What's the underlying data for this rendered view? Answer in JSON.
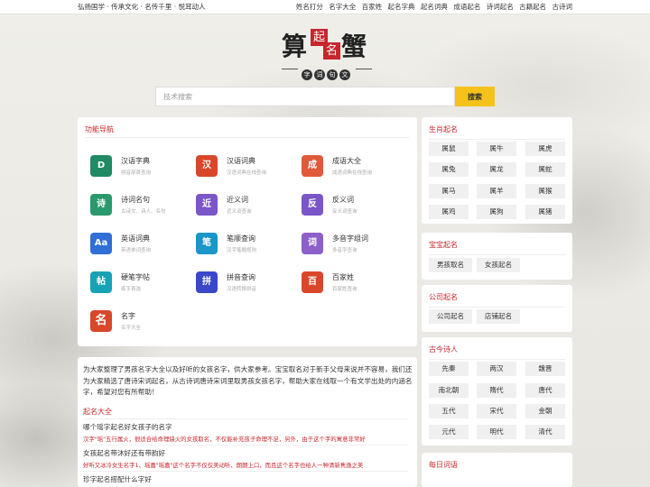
{
  "topbar": {
    "slogan": "弘扬国学 · 传承文化 · 名传千里 · 悦耳动人",
    "links": [
      "姓名打分",
      "名字大全",
      "百家姓",
      "起名字典",
      "起名词典",
      "成语起名",
      "诗词起名",
      "古籍起名",
      "古诗词"
    ]
  },
  "logo": {
    "char1": "算",
    "seal1": "起",
    "seal2": "名",
    "char2": "蟹",
    "sub": [
      "字",
      "词",
      "句",
      "文"
    ]
  },
  "search": {
    "placeholder": "技术搜索",
    "button": "搜索"
  },
  "funcnav": {
    "title": "功能导航",
    "tools": [
      {
        "name": "汉语字典",
        "desc": "拼音部首查询",
        "glyph": "D",
        "color": "#1f8a63"
      },
      {
        "name": "汉语词典",
        "desc": "汉语词典在线查询",
        "glyph": "汉",
        "color": "#d9472b"
      },
      {
        "name": "成语大全",
        "desc": "成语词典在线查询",
        "glyph": "成",
        "color": "#e05a3a"
      },
      {
        "name": "诗词名句",
        "desc": "古诗文、诗人、名句",
        "glyph": "诗",
        "color": "#2a9a6c"
      },
      {
        "name": "近义词",
        "desc": "近义词查询",
        "glyph": "近",
        "color": "#7a56c9"
      },
      {
        "name": "反义词",
        "desc": "反义词查询",
        "glyph": "反",
        "color": "#7a56c9"
      },
      {
        "name": "英语词典",
        "desc": "英语单词查询",
        "glyph": "Aa",
        "color": "#2f6fd6"
      },
      {
        "name": "笔顺查询",
        "desc": "汉字笔顺规则",
        "glyph": "笔",
        "color": "#1a96c8"
      },
      {
        "name": "多音字组词",
        "desc": "多音字查询",
        "glyph": "词",
        "color": "#8c5fc9"
      },
      {
        "name": "硬笔字帖",
        "desc": "练字首选",
        "glyph": "帖",
        "color": "#16a3b5"
      },
      {
        "name": "拼音查询",
        "desc": "汉语转换拼音",
        "glyph": "拼",
        "color": "#3b47c9"
      },
      {
        "name": "百家姓",
        "desc": "百家姓查询",
        "glyph": "百",
        "color": "#d9472b"
      },
      {
        "name": "名字",
        "desc": "名字大全",
        "glyph": "名",
        "color": "#d9472b"
      }
    ]
  },
  "intro": {
    "desc": "为大家整理了男孩名字大全以及好听的女孩名字，供大家参考。宝宝取名对于新手父母来说并不容易，我们还为大家精选了唐诗宋词起名，从古诗词唐诗宋词里取男孩女孩名字，帮助大家在线取一个有文学出处的内涵名字，希望对您有所帮助！",
    "section_title": "起名大全",
    "articles": [
      {
        "q": "哪个瑶字起名好女孩子的名字",
        "a": "汉字\"瑶\"五行属火，很适合给命理缺火的女孩取名，不仅能补充孩子命理不足，另外，由于这个字的寓意非常好"
      },
      {
        "q": "女孩起名带沐好还有带韵好",
        "a": "好听又冰冷女生名字1、瑶嘉\"瑶嘉\"这个名字不仅仅美动听、朗朗上口，而且这个名字也给人一种清新隽逸之美"
      },
      {
        "q": "珍字起名搭配什么字好",
        "a": ""
      }
    ]
  },
  "zodiac": {
    "title": "生肖起名",
    "items": [
      "属鼠",
      "属牛",
      "属虎",
      "属兔",
      "属龙",
      "属蛇",
      "属马",
      "属羊",
      "属猴",
      "属鸡",
      "属狗",
      "属猪"
    ]
  },
  "baby": {
    "title": "宝宝起名",
    "items": [
      "男孩取名",
      "女孩起名"
    ]
  },
  "company": {
    "title": "公司起名",
    "items": [
      "公司起名",
      "店铺起名"
    ]
  },
  "poets": {
    "title": "古今诗人",
    "items": [
      "先秦",
      "两汉",
      "魏晋",
      "南北朝",
      "隋代",
      "唐代",
      "五代",
      "宋代",
      "金朝",
      "元代",
      "明代",
      "清代"
    ]
  },
  "daily": {
    "title": "每日词语"
  }
}
